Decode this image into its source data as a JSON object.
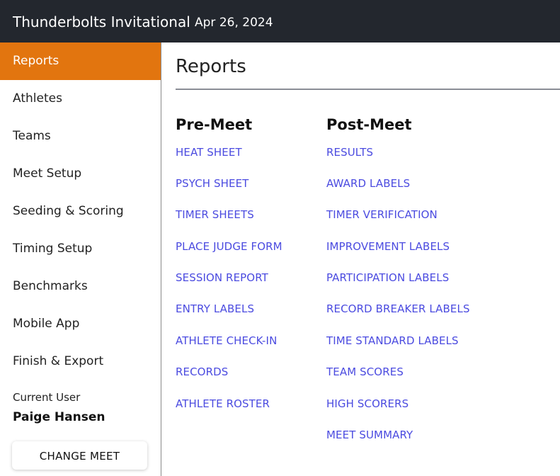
{
  "header": {
    "meet_name": "Thunderbolts Invitational",
    "meet_date": "Apr 26, 2024",
    "background_color": "#23272e"
  },
  "sidebar": {
    "active_color": "#e2750f",
    "items": [
      {
        "label": "Reports",
        "active": true
      },
      {
        "label": "Athletes",
        "active": false
      },
      {
        "label": "Teams",
        "active": false
      },
      {
        "label": "Meet Setup",
        "active": false
      },
      {
        "label": "Seeding & Scoring",
        "active": false
      },
      {
        "label": "Timing Setup",
        "active": false
      },
      {
        "label": "Benchmarks",
        "active": false
      },
      {
        "label": "Mobile App",
        "active": false
      },
      {
        "label": "Finish & Export",
        "active": false
      }
    ],
    "current_user_label": "Current User",
    "current_user_name": "Paige Hansen",
    "change_meet_label": "CHANGE MEET"
  },
  "main": {
    "title": "Reports",
    "link_color": "#4b4be0",
    "pre_meet": {
      "heading": "Pre-Meet",
      "links": [
        "HEAT SHEET",
        "PSYCH SHEET",
        "TIMER SHEETS",
        "PLACE JUDGE FORM",
        "SESSION REPORT",
        "ENTRY LABELS",
        "ATHLETE CHECK-IN",
        "RECORDS",
        "ATHLETE ROSTER"
      ]
    },
    "post_meet": {
      "heading": "Post-Meet",
      "links": [
        "RESULTS",
        "AWARD LABELS",
        "TIMER VERIFICATION",
        "IMPROVEMENT LABELS",
        "PARTICIPATION LABELS",
        "RECORD BREAKER LABELS",
        "TIME STANDARD LABELS",
        "TEAM SCORES",
        "HIGH SCORERS",
        "MEET SUMMARY"
      ]
    }
  }
}
